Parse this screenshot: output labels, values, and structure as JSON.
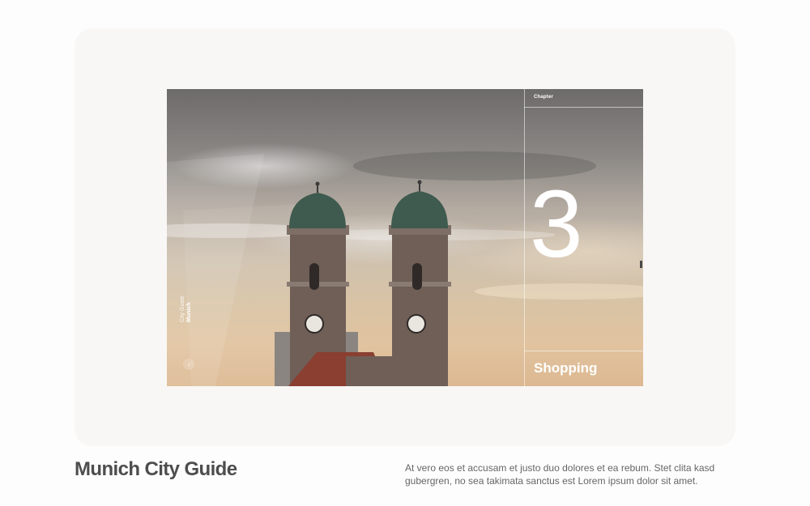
{
  "hero": {
    "chapter_label": "Chapter",
    "chapter_number": "3",
    "chapter_name": "Shopping",
    "brand_subtitle": "City Guide",
    "brand_title": "Munich",
    "scroll_icon": "arrow-down-icon"
  },
  "footer": {
    "title": "Munich City Guide",
    "description": "At vero eos et accusam et justo duo dolores et ea rebum. Stet clita kasd gubergren, no sea takimata sanctus est Lorem ipsum dolor sit amet."
  },
  "colors": {
    "page_background": "#fdfdfd",
    "card_background": "#f8f7f5",
    "title_text": "#4d4d4d",
    "body_text": "#666666",
    "overlay_text": "#ffffff"
  }
}
